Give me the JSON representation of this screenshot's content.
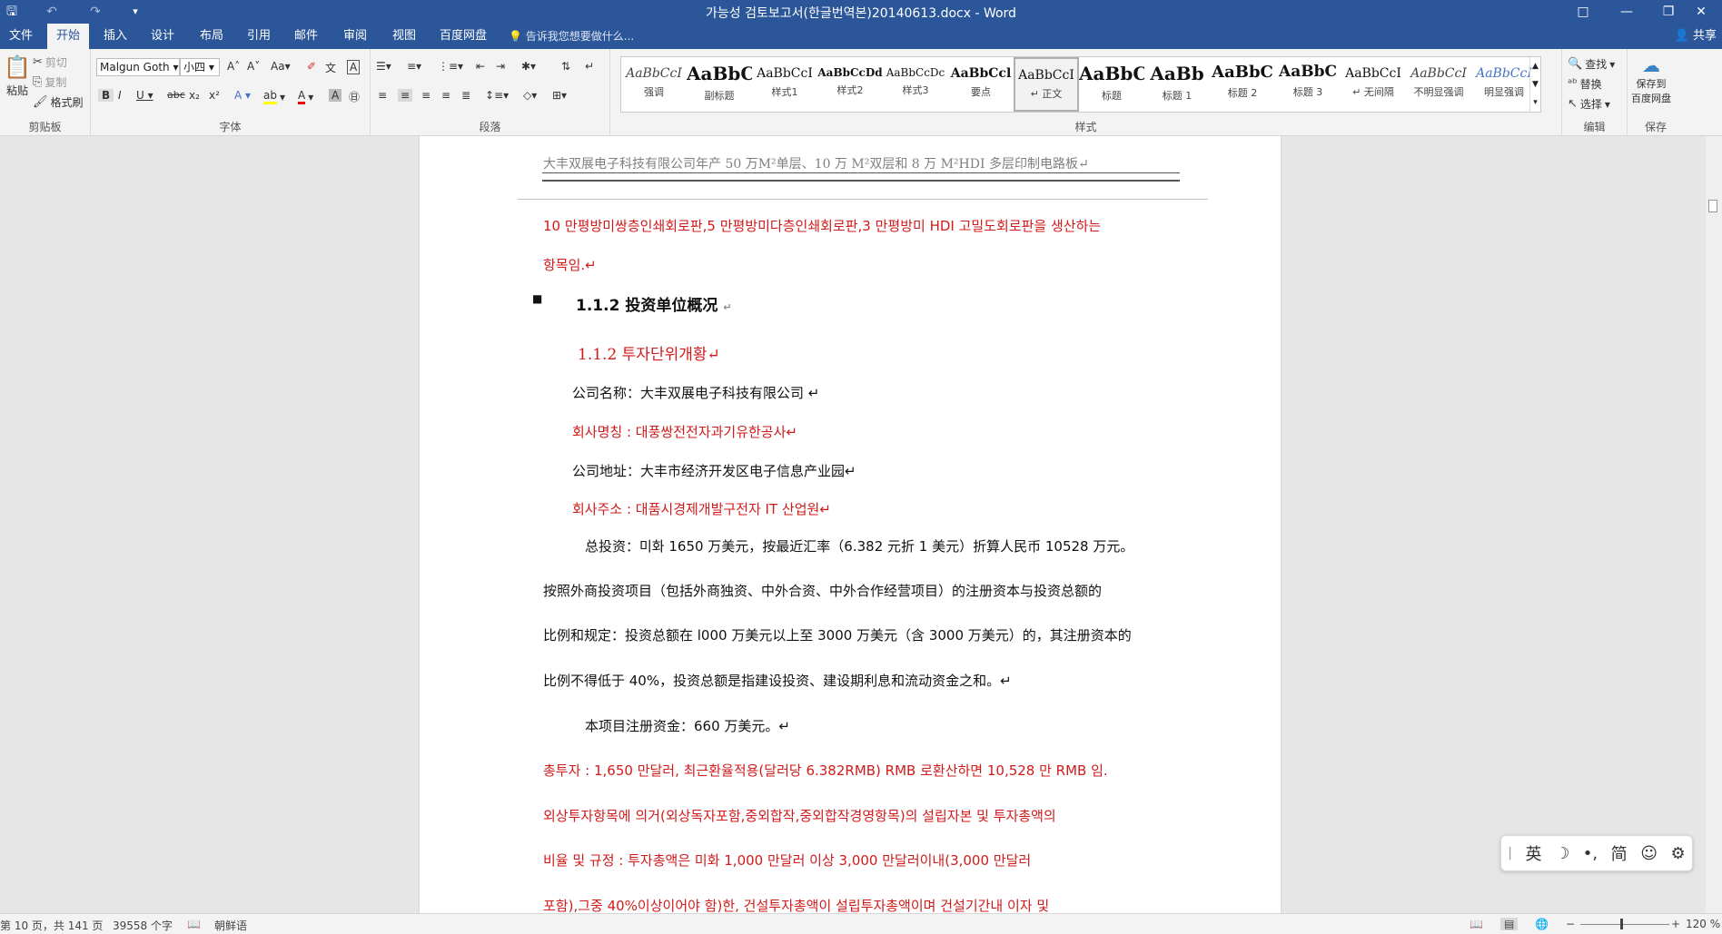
{
  "title_bar": {
    "title": "가능성 검토보고서(한글번역본)20140613.docx - Word",
    "window_buttons": {
      "ribbon_display": "□",
      "minimize": "—",
      "restore": "❐",
      "close": "✕"
    }
  },
  "tabs": [
    {
      "label": "文件"
    },
    {
      "label": "开始"
    },
    {
      "label": "插入"
    },
    {
      "label": "设计"
    },
    {
      "label": "布局"
    },
    {
      "label": "引用"
    },
    {
      "label": "邮件"
    },
    {
      "label": "审阅"
    },
    {
      "label": "视图"
    },
    {
      "label": "百度网盘"
    }
  ],
  "tell_me": "告诉我您想要做什么...",
  "share": "共享",
  "ribbon": {
    "clipboard": {
      "paste": "粘贴",
      "cut": "剪切",
      "copy": "复制",
      "format_painter": "格式刷",
      "label": "剪贴板"
    },
    "font": {
      "font_name": "Malgun Goth",
      "font_size": "小四",
      "label": "字体"
    },
    "paragraph": {
      "label": "段落"
    },
    "styles": {
      "label": "样式",
      "items": [
        {
          "preview": "AaBbCcI",
          "name": "强调"
        },
        {
          "preview": "AaBbC",
          "name": "副标题"
        },
        {
          "preview": "AaBbCcI",
          "name": "样式1"
        },
        {
          "preview": "AaBbCcDd",
          "name": "样式2"
        },
        {
          "preview": "AaBbCcDc",
          "name": "样式3"
        },
        {
          "preview": "AaBbCcl",
          "name": "要点"
        },
        {
          "preview": "AaBbCcI",
          "name": "↵ 正文"
        },
        {
          "preview": "AaBbC",
          "name": "标题"
        },
        {
          "preview": "AaBb",
          "name": "标题 1"
        },
        {
          "preview": "AaBbC",
          "name": "标题 2"
        },
        {
          "preview": "AaBbC",
          "name": "标题 3"
        },
        {
          "preview": "AaBbCcI",
          "name": "↵ 无间隔"
        },
        {
          "preview": "AaBbCcI",
          "name": "不明显强调"
        },
        {
          "preview": "AaBbCcI",
          "name": "明显强调"
        }
      ]
    },
    "editing": {
      "find": "查找",
      "replace": "替换",
      "select": "选择",
      "label": "编辑"
    },
    "save": {
      "line1": "保存到",
      "line2": "百度网盘",
      "label": "保存"
    }
  },
  "document": {
    "header": "大丰双展电子科技有限公司年产 50 万M²单层、10 万 M²双层和 8 万 M²HDI 多层印制电路板↵",
    "lines": [
      "10 만평방미쌍층인쇄회로판,5 만평방미다층인쇄회로판,3 만평방미  HDI 고밀도회로판을  생산하는",
      "항목임.↵",
      "1.1.2  投资单位概况",
      "1.1.2  투자단위개황↵",
      "公司名称：大丰双展电子科技有限公司  ↵",
      "회사명칭 : 대풍쌍전전자과기유한공사↵",
      "公司地址：大丰市经济开发区电子信息产业园↵",
      "회사주소 : 대품시경제개발구전자 IT 산업원↵",
      "总投资：미화 1650 万美元，按最近汇率（6.382 元折 1 美元）折算人民币 10528 万元。",
      "按照外商投资项目（包括外商独资、中外合资、中外合作经营项目）的注册资本与投资总额的",
      "比例和规定：投资总额在 l000 万美元以上至 3000 万美元（含 3000 万美元）的，其注册资本的",
      "比例不得低于 40%，投资总额是指建设投资、建设期利息和流动资金之和。↵",
      "本项目注册资金：660 万美元。↵",
      "총투자 : 1,650 만달러,  최근환율적용(달러당 6.382RMB) RMB 로환산하면  10,528 만 RMB 임.",
      "외상투자항목에  의거(외상독자포함,중외합작,중외합작경영항목)의  설립자본  및  투자총액의",
      "비율  및  규정 : 투자총액은  미화  1,000 만달러  이상  3,000 만달러이내(3,000 만달러",
      "포함),그중  40%이상이어야  함)한,  건설투자총액이  설립투자총액이며  건설기간내  이자  및"
    ],
    "heading_mark": "↵"
  },
  "status_bar": {
    "page": "第 10 页，共 141 页",
    "words": "39558 个字",
    "language": "朝鲜语",
    "zoom": "120 %"
  },
  "ime": {
    "lang": "英",
    "simplified": "简"
  }
}
